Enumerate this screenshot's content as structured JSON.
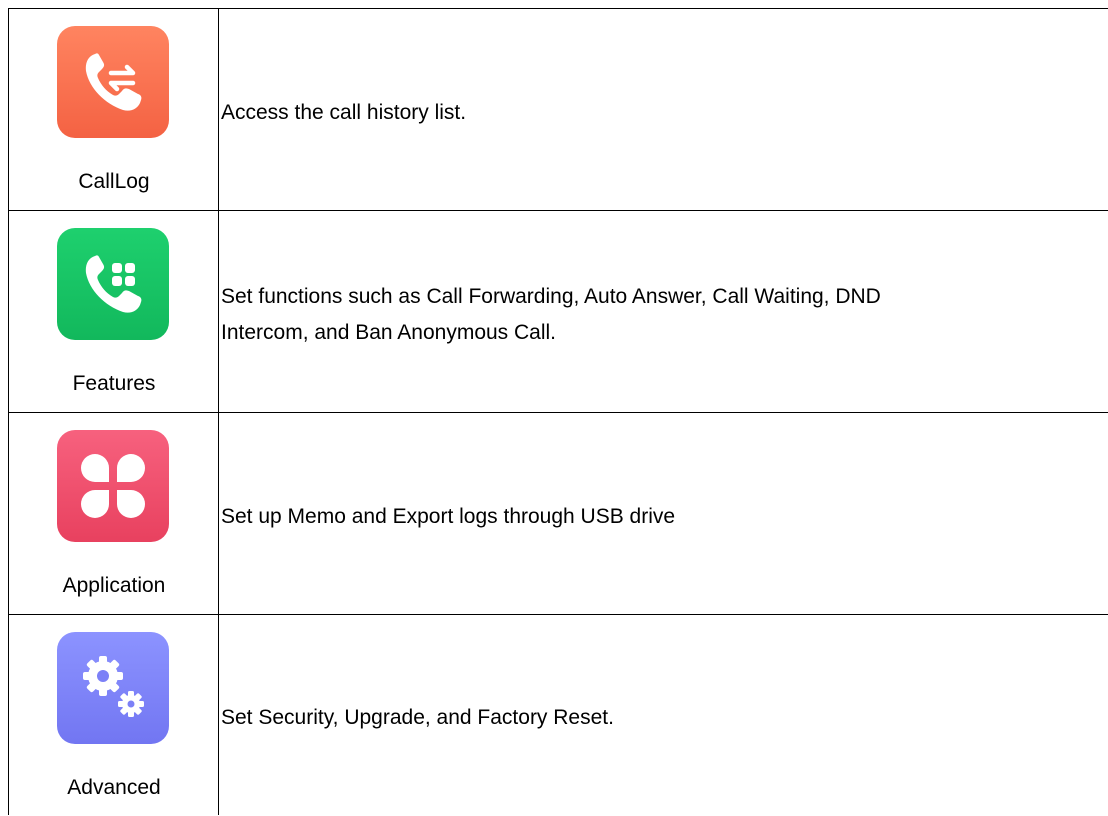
{
  "menu": {
    "items": [
      {
        "label": "CallLog",
        "icon": "call-log-icon",
        "color": "#f86a4a",
        "description": "Access the call history list."
      },
      {
        "label": "Features",
        "icon": "features-icon",
        "color": "#17c163",
        "description": "Set functions such as Call Forwarding, Auto Answer, Call Waiting, DND\nIntercom, and Ban Anonymous Call."
      },
      {
        "label": "Application",
        "icon": "application-icon",
        "color": "#ee4b69",
        "description": "Set up Memo and Export logs through USB drive"
      },
      {
        "label": "Advanced",
        "icon": "advanced-icon",
        "color": "#7c80f7",
        "description": "Set Security, Upgrade, and Factory Reset."
      }
    ]
  }
}
